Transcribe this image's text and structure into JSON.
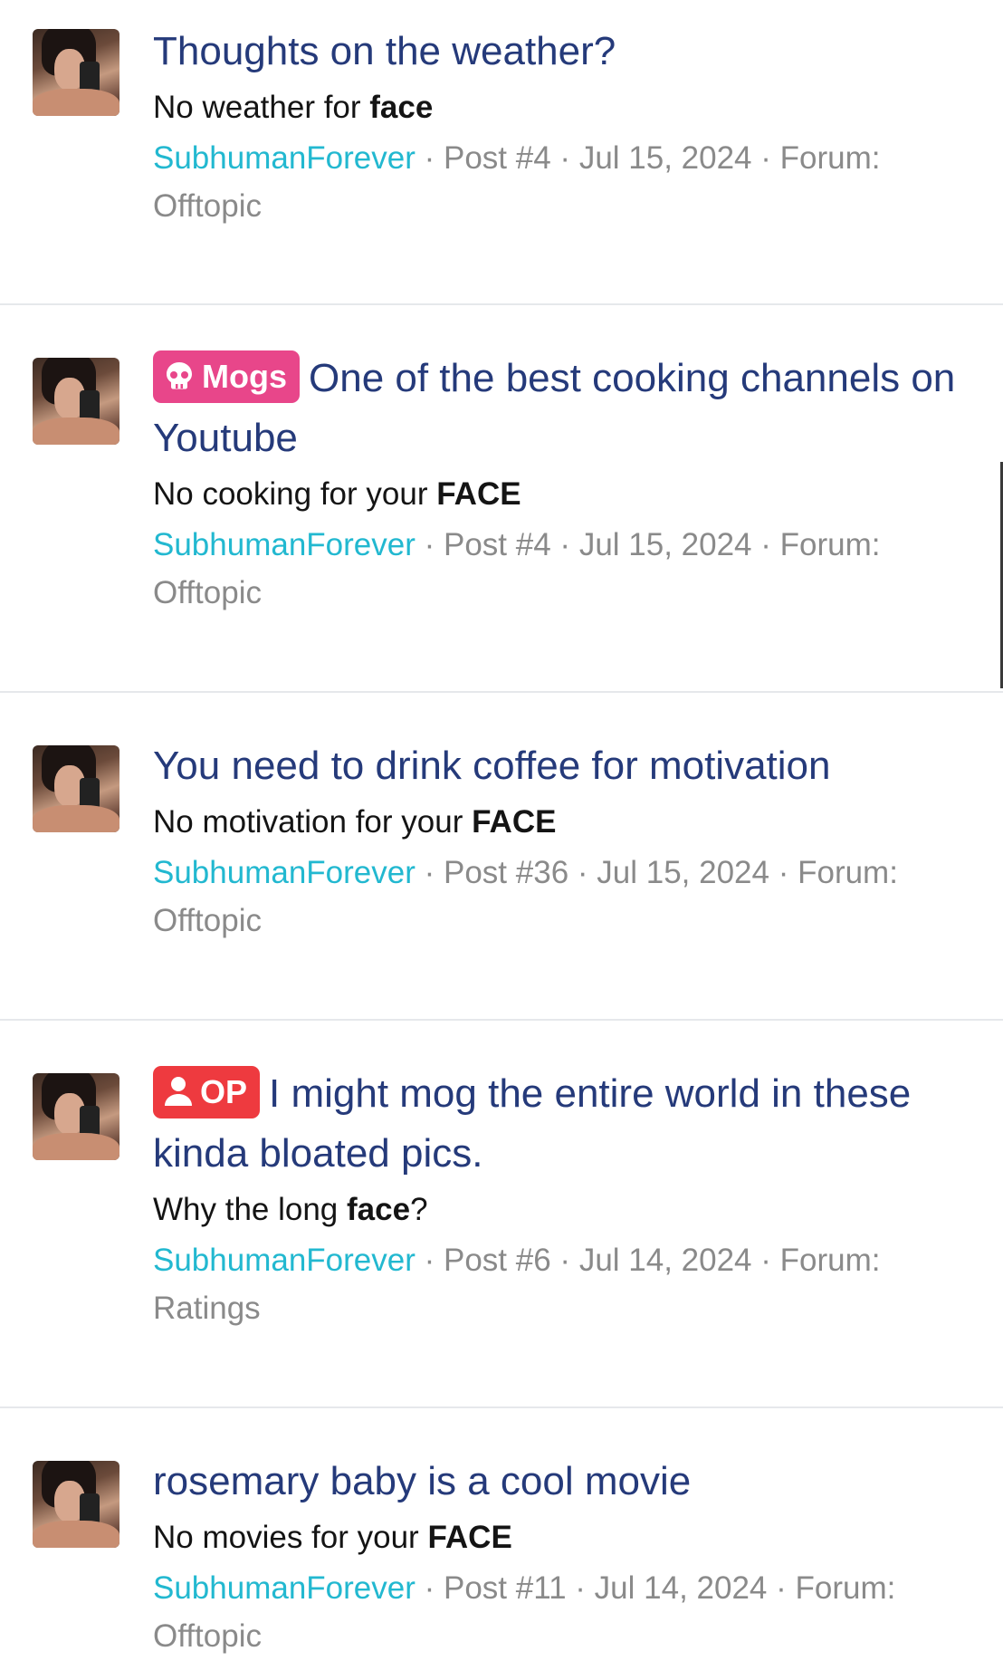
{
  "results": [
    {
      "badge": null,
      "title": "Thoughts on the weather?",
      "snippet_prefix": "No weather for ",
      "snippet_bold": "face",
      "snippet_suffix": "",
      "author": "SubhumanForever",
      "post": "Post #4",
      "date": "Jul 15, 2024",
      "forum_label": "Forum:",
      "forum": "Offtopic"
    },
    {
      "badge": {
        "label": "Mogs",
        "icon": "skull-icon",
        "color": "#e8468a"
      },
      "title": "One of the best cooking channels on Youtube",
      "snippet_prefix": "No cooking for your ",
      "snippet_bold": "FACE",
      "snippet_suffix": "",
      "author": "SubhumanForever",
      "post": "Post #4",
      "date": "Jul 15, 2024",
      "forum_label": "Forum:",
      "forum": "Offtopic"
    },
    {
      "badge": null,
      "title": "You need to drink coffee for motivation",
      "snippet_prefix": "No motivation for your ",
      "snippet_bold": "FACE",
      "snippet_suffix": "",
      "author": "SubhumanForever",
      "post": "Post #36",
      "date": "Jul 15, 2024",
      "forum_label": "Forum:",
      "forum": "Offtopic"
    },
    {
      "badge": {
        "label": "OP",
        "icon": "user-icon",
        "color": "#ee3a3f"
      },
      "title": "I might mog the entire world in these kinda bloated pics.",
      "snippet_prefix": "Why the long ",
      "snippet_bold": "face",
      "snippet_suffix": "?",
      "author": "SubhumanForever",
      "post": "Post #6",
      "date": "Jul 14, 2024",
      "forum_label": "Forum:",
      "forum": "Ratings"
    },
    {
      "badge": null,
      "title": "rosemary baby is a cool movie",
      "snippet_prefix": "No movies for your ",
      "snippet_bold": "FACE",
      "snippet_suffix": "",
      "author": "SubhumanForever",
      "post": "Post #11",
      "date": "Jul 14, 2024",
      "forum_label": "Forum:",
      "forum": "Offtopic"
    }
  ],
  "separator": " · ",
  "colors": {
    "title": "#253a7a",
    "author": "#22b8d0",
    "meta": "#8a8a8a",
    "snippet": "#141414"
  }
}
